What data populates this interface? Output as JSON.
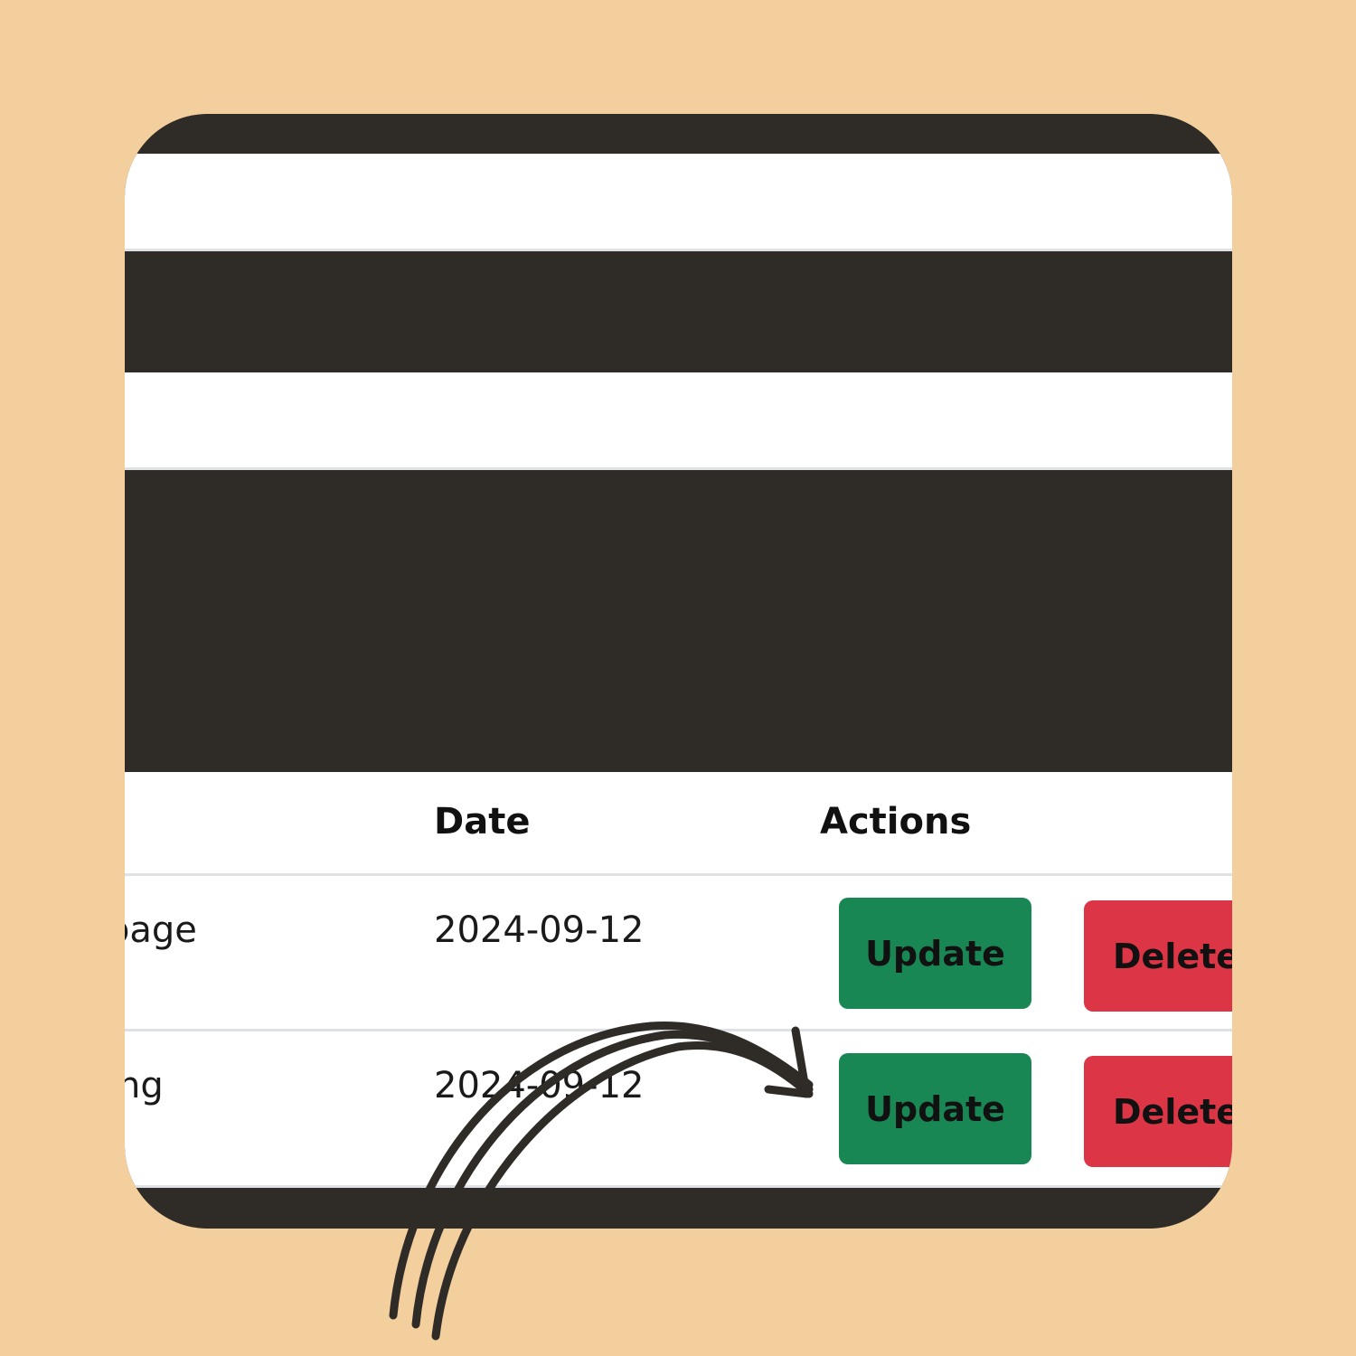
{
  "table": {
    "headers": {
      "date": "Date",
      "actions": "Actions"
    },
    "rows": [
      {
        "name_partial": "page",
        "date": "2024-09-12",
        "update_label": "Update",
        "delete_label": "Delete"
      },
      {
        "name_partial": "ng",
        "date": "2024-09-12",
        "update_label": "Update",
        "delete_label": "Delete"
      }
    ]
  },
  "colors": {
    "background": "#f2cf9d",
    "dark_band": "#2f2b27",
    "update_button": "#198754",
    "delete_button": "#dc3545",
    "arrow": "#2f2b27"
  },
  "icons": [
    "curved-arrow-icon"
  ]
}
